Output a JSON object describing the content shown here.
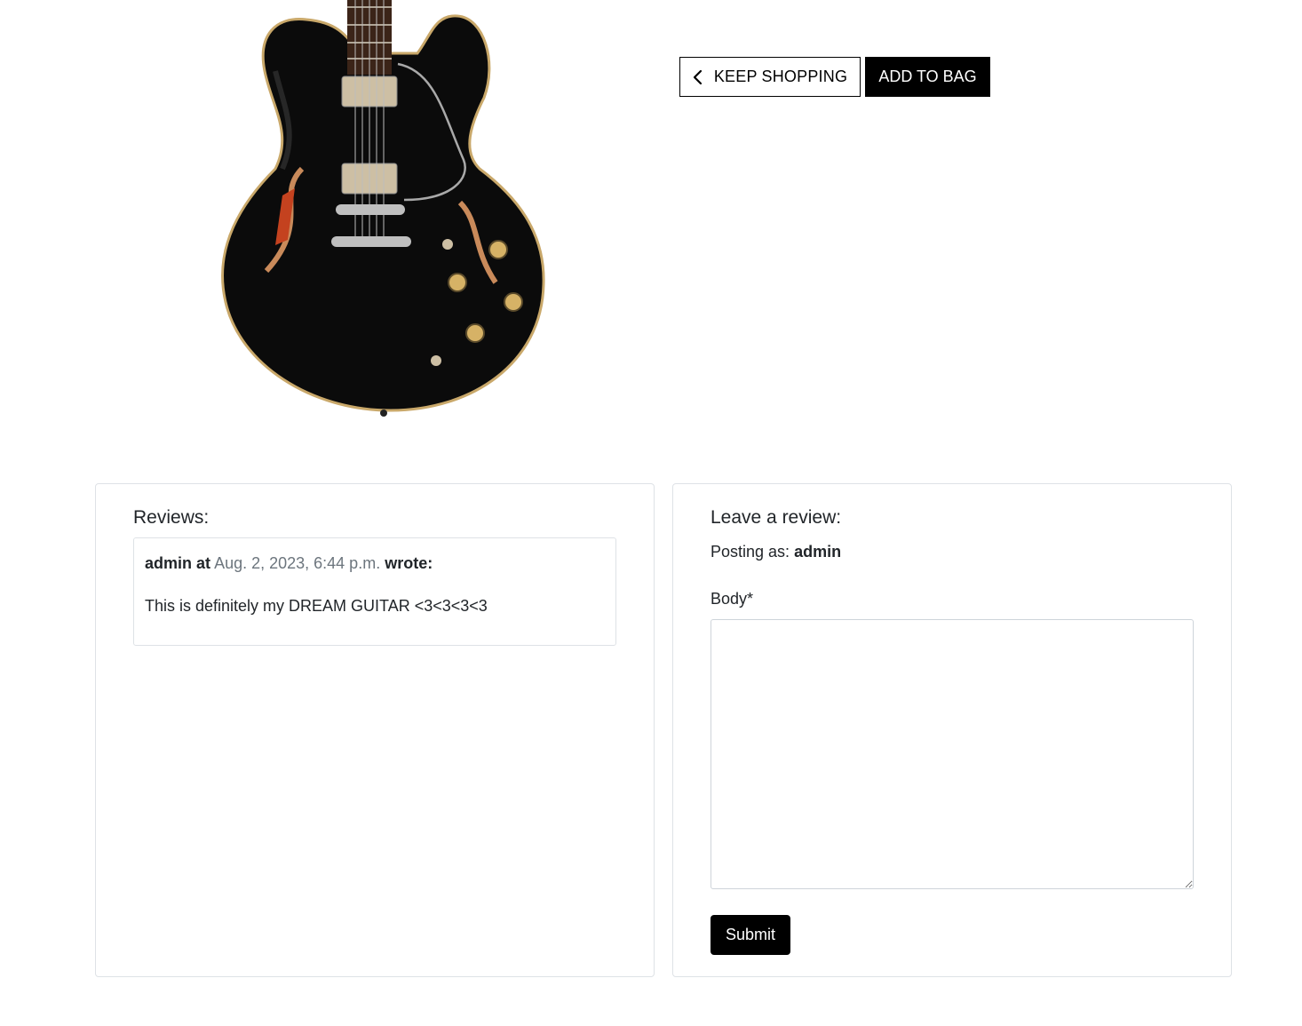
{
  "product": {
    "image_alt": "Black semi-hollow electric guitar"
  },
  "actions": {
    "keep_shopping_label": "KEEP SHOPPING",
    "add_to_bag_label": "ADD TO BAG"
  },
  "reviews": {
    "heading": "Reviews:",
    "items": [
      {
        "author": "admin",
        "at_word": "at",
        "date": "Aug. 2, 2023, 6:44 p.m.",
        "wrote_word": "wrote:",
        "body": "This is definitely my DREAM GUITAR <3<3<3<3"
      }
    ]
  },
  "review_form": {
    "heading": "Leave a review:",
    "posting_as_prefix": "Posting as:",
    "posting_as_user": "admin",
    "body_label": "Body*",
    "body_value": "",
    "submit_label": "Submit"
  },
  "colors": {
    "primary_button": "#000000",
    "muted_text": "#6c757d",
    "card_border": "#dee2e6"
  }
}
